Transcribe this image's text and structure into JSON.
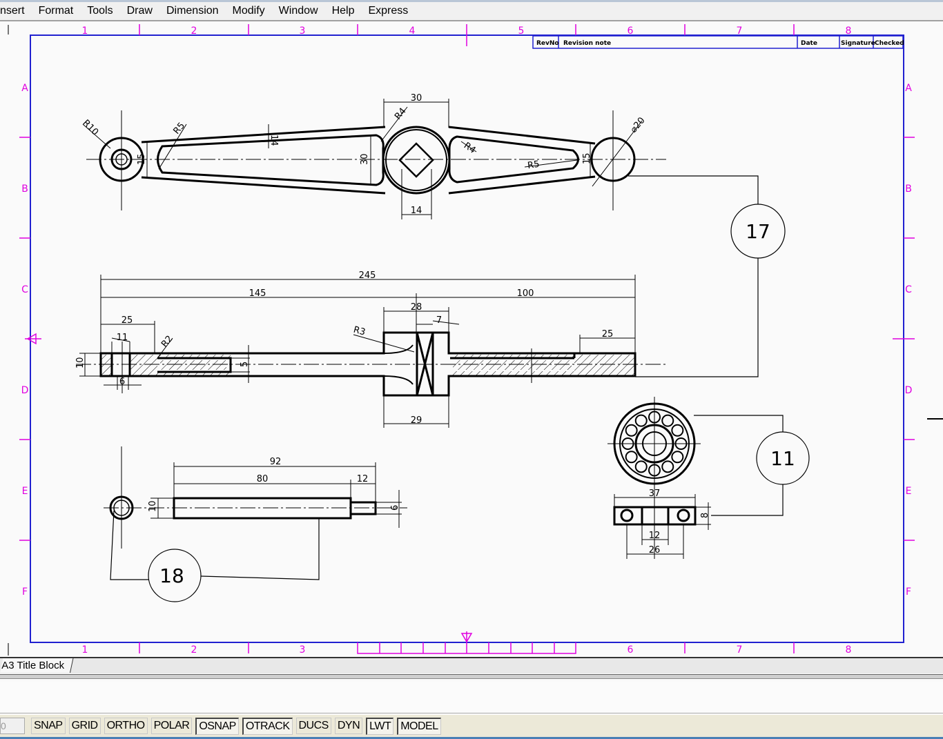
{
  "menu": [
    "nsert",
    "Format",
    "Tools",
    "Draw",
    "Dimension",
    "Modify",
    "Window",
    "Help",
    "Express"
  ],
  "rulers": {
    "columns": [
      "1",
      "2",
      "3",
      "4",
      "5",
      "6",
      "7",
      "8"
    ],
    "rows": [
      "A",
      "B",
      "C",
      "D",
      "E",
      "F"
    ]
  },
  "revision_table": {
    "headers": [
      "RevNo",
      "Revision note",
      "Date",
      "Signature",
      "Checked"
    ]
  },
  "balloons": {
    "b17": "17",
    "b18": "18",
    "b11": "11"
  },
  "dims": {
    "d30top": "30",
    "r4a": "R4",
    "r10": "R10",
    "r5a": "R5",
    "d14a": "14",
    "d15a": "15",
    "d30side": "30",
    "r4b": "R4",
    "r5b": "R5",
    "d15b": "15",
    "dia20": "⌀20",
    "d14b": "14",
    "d245": "245",
    "d145": "145",
    "d100": "100",
    "d28": "28",
    "d7": "7",
    "d25a": "25",
    "r3": "R3",
    "r2": "R2",
    "d11": "11",
    "d10a": "10",
    "d5": "5",
    "d6a": "6",
    "d25b": "25",
    "d29": "29",
    "d92": "92",
    "d80": "80",
    "d12a": "12",
    "d10b": "10",
    "d6b": "6",
    "d37": "37",
    "d8": "8",
    "d12b": "12",
    "d26": "26"
  },
  "layout_tab": "A3 Title Block",
  "status_buttons": [
    {
      "label": "SNAP",
      "on": false
    },
    {
      "label": "GRID",
      "on": false
    },
    {
      "label": "ORTHO",
      "on": false
    },
    {
      "label": "POLAR",
      "on": false
    },
    {
      "label": "OSNAP",
      "on": true
    },
    {
      "label": "OTRACK",
      "on": true
    },
    {
      "label": "DUCS",
      "on": false
    },
    {
      "label": "DYN",
      "on": false
    },
    {
      "label": "LWT",
      "on": true
    },
    {
      "label": "MODEL",
      "on": true
    }
  ],
  "coord_readout": "0",
  "colors": {
    "border": "#2020d0",
    "ruler": "#e000e0",
    "geometry": "#000000"
  }
}
